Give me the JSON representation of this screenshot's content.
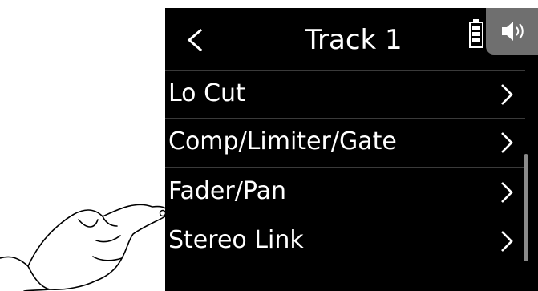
{
  "header": {
    "title": "Track 1",
    "back_icon": "chevron-left-icon",
    "battery_icon": "battery-icon",
    "speaker_icon": "speaker-icon"
  },
  "menu": {
    "items": [
      {
        "label": "Lo Cut"
      },
      {
        "label": "Comp/Limiter/Gate"
      },
      {
        "label": "Fader/Pan"
      },
      {
        "label": "Stereo Link"
      }
    ]
  },
  "colors": {
    "background": "#000000",
    "text": "#ffffff",
    "divider": "#3a3a3a",
    "speaker_tab": "#6f6f6f",
    "scrollbar": "#8a8a8a"
  }
}
